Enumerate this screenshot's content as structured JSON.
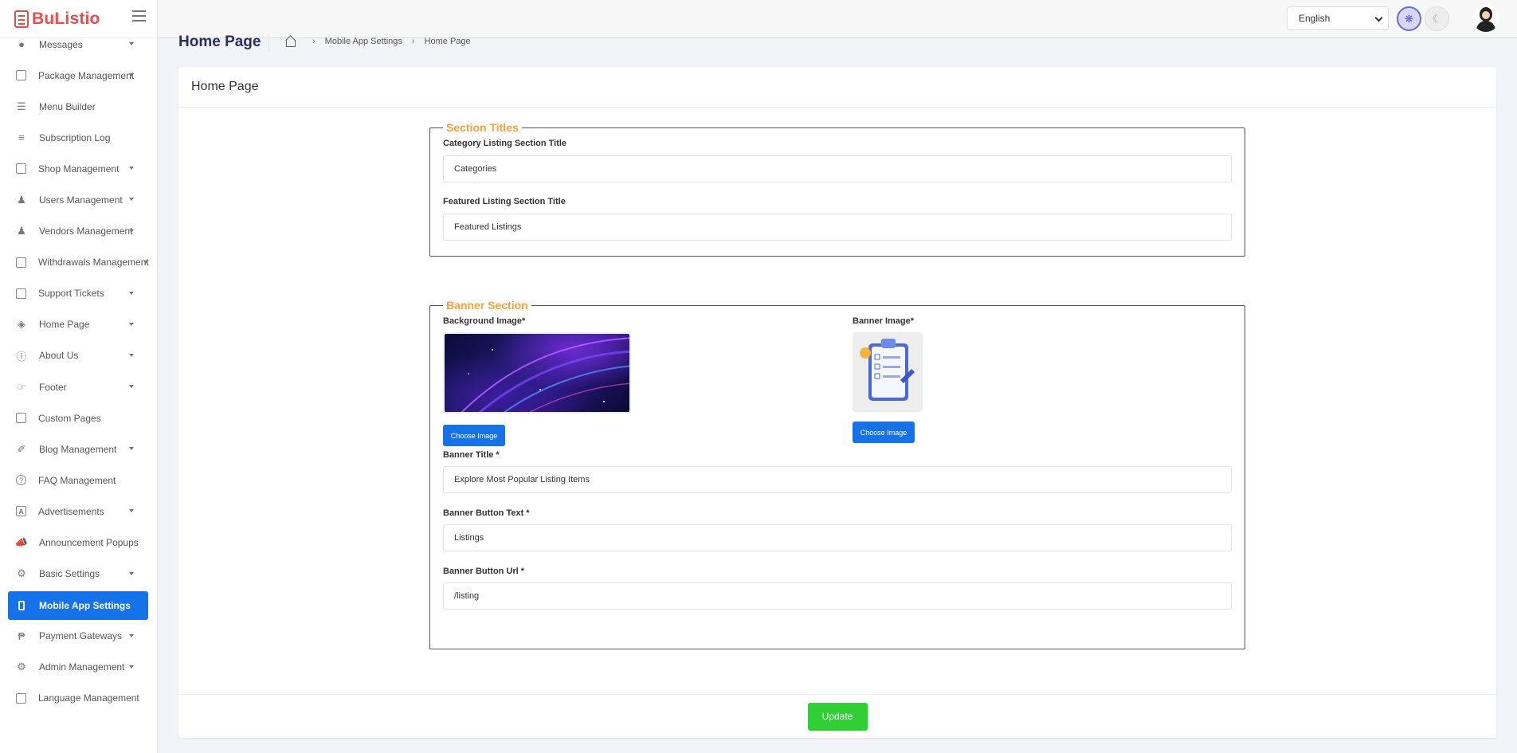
{
  "brand": {
    "name": "BuListio"
  },
  "sidebar": {
    "items": [
      {
        "label": "Messages",
        "icon": "chat-icon",
        "has_caret": true
      },
      {
        "label": "Package Management",
        "icon": "package-icon",
        "has_caret": true
      },
      {
        "label": "Menu Builder",
        "icon": "menu-icon",
        "has_caret": false
      },
      {
        "label": "Subscription Log",
        "icon": "list-icon",
        "has_caret": false
      },
      {
        "label": "Shop Management",
        "icon": "shop-icon",
        "has_caret": true
      },
      {
        "label": "Users Management",
        "icon": "users-icon",
        "has_caret": true
      },
      {
        "label": "Vendors Management",
        "icon": "vendors-icon",
        "has_caret": true
      },
      {
        "label": "Withdrawals Management",
        "icon": "credit-card-icon",
        "has_caret": true
      },
      {
        "label": "Support Tickets",
        "icon": "ticket-icon",
        "has_caret": true
      },
      {
        "label": "Home Page",
        "icon": "layers-icon",
        "has_caret": true
      },
      {
        "label": "About Us",
        "icon": "info-icon",
        "has_caret": true
      },
      {
        "label": "Footer",
        "icon": "hand-icon",
        "has_caret": true
      },
      {
        "label": "Custom Pages",
        "icon": "page-icon",
        "has_caret": false
      },
      {
        "label": "Blog Management",
        "icon": "blog-icon",
        "has_caret": true
      },
      {
        "label": "FAQ Management",
        "icon": "question-icon",
        "has_caret": false
      },
      {
        "label": "Advertisements",
        "icon": "ad-icon",
        "has_caret": true
      },
      {
        "label": "Announcement Popups",
        "icon": "megaphone-icon",
        "has_caret": false
      },
      {
        "label": "Basic Settings",
        "icon": "gear-icon",
        "has_caret": true
      },
      {
        "label": "Mobile App Settings",
        "icon": "mobile-icon",
        "has_caret": false,
        "active": true
      },
      {
        "label": "Payment Gateways",
        "icon": "payment-icon",
        "has_caret": true
      },
      {
        "label": "Admin Management",
        "icon": "admin-icon",
        "has_caret": true
      },
      {
        "label": "Language Management",
        "icon": "language-icon",
        "has_caret": false
      }
    ]
  },
  "header": {
    "language": "English",
    "theme_light_icon": "sun-icon",
    "theme_dark_icon": "moon-icon"
  },
  "page": {
    "title": "Home Page",
    "breadcrumb": [
      "Mobile App Settings",
      "Home Page"
    ]
  },
  "card": {
    "title": "Home Page",
    "update_label": "Update"
  },
  "section_titles": {
    "legend": "Section Titles",
    "category_label": "Category Listing Section Title",
    "category_value": "Categories",
    "featured_label": "Featured Listing Section Title",
    "featured_value": "Featured Listings"
  },
  "banner": {
    "legend": "Banner Section",
    "background_label": "Background Image*",
    "banner_image_label": "Banner Image*",
    "choose_label": "Choose Image",
    "title_label": "Banner Title *",
    "title_value": "Explore Most Popular Listing Items",
    "button_text_label": "Banner Button Text *",
    "button_text_value": "Listings",
    "button_url_label": "Banner Button Url *",
    "button_url_value": "/listing"
  },
  "colors": {
    "brand": "#e84c4c",
    "primary": "#1572e8",
    "success": "#31ce36",
    "legend": "#f6a23c"
  }
}
